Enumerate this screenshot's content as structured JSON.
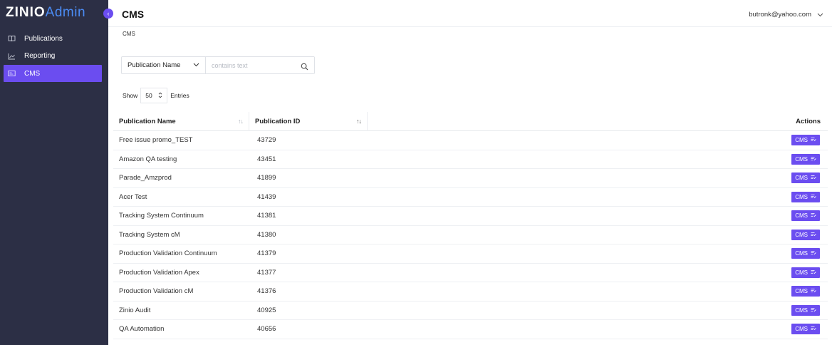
{
  "brand": {
    "logo_part1": "ZINIO",
    "logo_part2": "Admin"
  },
  "sidebar": {
    "items": [
      {
        "label": "Publications",
        "icon": "book-icon",
        "active": false
      },
      {
        "label": "Reporting",
        "icon": "chart-line-icon",
        "active": false
      },
      {
        "label": "CMS",
        "icon": "cms-icon",
        "active": true
      }
    ]
  },
  "header": {
    "title": "CMS",
    "user_email": "butronk@yahoo.com"
  },
  "breadcrumb": "CMS",
  "filter": {
    "field_label": "Publication Name",
    "placeholder": "contains text",
    "value": ""
  },
  "entries": {
    "prefix": "Show",
    "value": "50",
    "suffix": "Entries"
  },
  "table": {
    "columns": [
      "Publication Name",
      "Publication ID",
      "Actions"
    ],
    "action_label": "CMS",
    "rows": [
      {
        "name": "Free issue promo_TEST",
        "id": "43729"
      },
      {
        "name": "Amazon QA testing",
        "id": "43451"
      },
      {
        "name": "Parade_Amzprod",
        "id": "41899"
      },
      {
        "name": "Acer Test",
        "id": "41439"
      },
      {
        "name": "Tracking System Continuum",
        "id": "41381"
      },
      {
        "name": "Tracking System cM",
        "id": "41380"
      },
      {
        "name": "Production Validation Continuum",
        "id": "41379"
      },
      {
        "name": "Production Validation Apex",
        "id": "41377"
      },
      {
        "name": "Production Validation cM",
        "id": "41376"
      },
      {
        "name": "Zinio Audit",
        "id": "40925"
      },
      {
        "name": "QA Automation",
        "id": "40656"
      }
    ]
  },
  "colors": {
    "sidebar_bg": "#2c2f45",
    "accent": "#6b4df0",
    "logo_admin": "#4b8cf5"
  }
}
